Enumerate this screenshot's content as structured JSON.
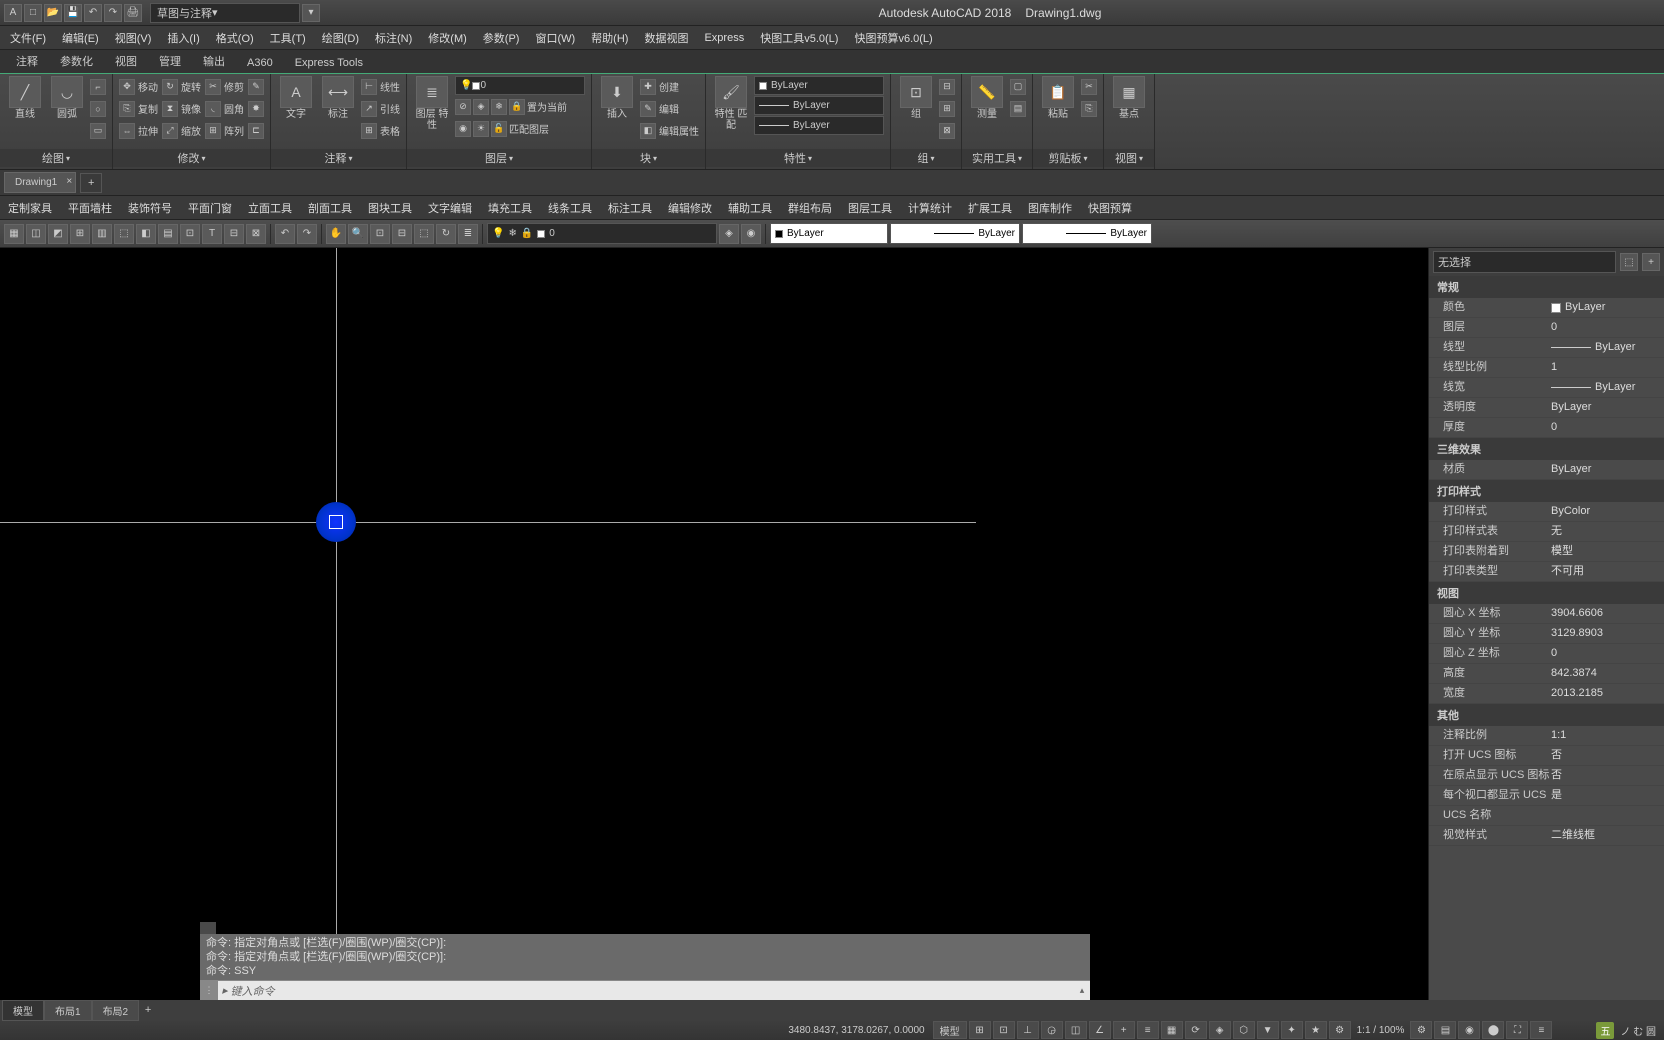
{
  "title": {
    "app": "Autodesk AutoCAD 2018",
    "file": "Drawing1.dwg",
    "workspace": "草图与注释"
  },
  "menubar": [
    "文件(F)",
    "编辑(E)",
    "视图(V)",
    "插入(I)",
    "格式(O)",
    "工具(T)",
    "绘图(D)",
    "标注(N)",
    "修改(M)",
    "参数(P)",
    "窗口(W)",
    "帮助(H)",
    "数据视图",
    "Express",
    "快图工具v5.0(L)",
    "快图预算v6.0(L)"
  ],
  "ribbon_tabs": [
    "注释",
    "参数化",
    "视图",
    "管理",
    "输出",
    "A360",
    "Express Tools"
  ],
  "ribbon": {
    "draw": {
      "line": "直线",
      "arc": "圆弧",
      "title": "绘图"
    },
    "modify": {
      "move": "移动",
      "rotate": "旋转",
      "trim": "修剪",
      "copy": "复制",
      "mirror": "镜像",
      "fillet": "圆角",
      "stretch": "拉伸",
      "scale": "缩放",
      "array": "阵列",
      "title": "修改"
    },
    "annot": {
      "text": "文字",
      "dim": "标注",
      "linear": "线性",
      "leader": "引线",
      "table": "表格",
      "title": "注释"
    },
    "layers": {
      "props": "图层\n特性",
      "current": "0",
      "off": "关",
      "iso": "隔离",
      "match": "置为当前",
      "matchlayer": "匹配图层",
      "title": "图层"
    },
    "block": {
      "insert": "插入",
      "create": "创建",
      "edit": "编辑",
      "attr": "编辑属性",
      "title": "块"
    },
    "props": {
      "match": "特性\n匹配",
      "color": "ByLayer",
      "ltype": "ByLayer",
      "lweight": "ByLayer",
      "title": "特性"
    },
    "group": {
      "group": "组",
      "title": "组"
    },
    "util": {
      "measure": "测量",
      "title": "实用工具"
    },
    "clip": {
      "paste": "粘贴",
      "title": "剪贴板"
    },
    "view": {
      "base": "基点",
      "title": "视图"
    }
  },
  "filetab": {
    "name": "Drawing1"
  },
  "tooltabs": [
    "定制家具",
    "平面墙柱",
    "装饰符号",
    "平面门窗",
    "立面工具",
    "剖面工具",
    "图块工具",
    "文字编辑",
    "填充工具",
    "线条工具",
    "标注工具",
    "编辑修改",
    "辅助工具",
    "群组布局",
    "图层工具",
    "计算统计",
    "扩展工具",
    "图库制作",
    "快图预算"
  ],
  "toolbar": {
    "layer_current": "0",
    "color": "ByLayer",
    "ltype": "ByLayer",
    "lweight": "ByLayer"
  },
  "properties": {
    "selection": "无选择",
    "general_h": "常规",
    "general": {
      "color_k": "颜色",
      "color_v": "ByLayer",
      "layer_k": "图层",
      "layer_v": "0",
      "ltype_k": "线型",
      "ltype_v": "ByLayer",
      "ltscale_k": "线型比例",
      "ltscale_v": "1",
      "lweight_k": "线宽",
      "lweight_v": "ByLayer",
      "transp_k": "透明度",
      "transp_v": "ByLayer",
      "thick_k": "厚度",
      "thick_v": "0"
    },
    "threed_h": "三维效果",
    "threed": {
      "mat_k": "材质",
      "mat_v": "ByLayer"
    },
    "plot_h": "打印样式",
    "plot": {
      "ps_k": "打印样式",
      "ps_v": "ByColor",
      "pst_k": "打印样式表",
      "pst_v": "无",
      "psa_k": "打印表附着到",
      "psa_v": "模型",
      "psty_k": "打印表类型",
      "psty_v": "不可用"
    },
    "view_h": "视图",
    "view": {
      "cx_k": "圆心 X 坐标",
      "cx_v": "3904.6606",
      "cy_k": "圆心 Y 坐标",
      "cy_v": "3129.8903",
      "cz_k": "圆心 Z 坐标",
      "cz_v": "0",
      "h_k": "高度",
      "h_v": "842.3874",
      "w_k": "宽度",
      "w_v": "2013.2185"
    },
    "misc_h": "其他",
    "misc": {
      "anno_k": "注释比例",
      "anno_v": "1:1",
      "ucs_k": "打开 UCS 图标",
      "ucs_v": "否",
      "ucso_k": "在原点显示 UCS 图标",
      "ucso_v": "否",
      "ucsv_k": "每个视口都显示 UCS",
      "ucsv_v": "是",
      "ucsn_k": "UCS 名称",
      "ucsn_v": "",
      "vs_k": "视觉样式",
      "vs_v": "二维线框"
    }
  },
  "cmd": {
    "hist1": "命令: 指定对角点或 [栏选(F)/圈围(WP)/圈交(CP)]:",
    "hist2": "命令: 指定对角点或 [栏选(F)/圈围(WP)/圈交(CP)]:",
    "hist3": "命令: SSY",
    "placeholder": "键入命令"
  },
  "layout_tabs": {
    "model": "模型",
    "l1": "布局1",
    "l2": "布局2"
  },
  "status": {
    "coords": "3480.8437, 3178.0267, 0.0000",
    "model": "模型",
    "scale": "1:1 / 100%",
    "ime": "五",
    "ime2": "ノ む 圆"
  }
}
